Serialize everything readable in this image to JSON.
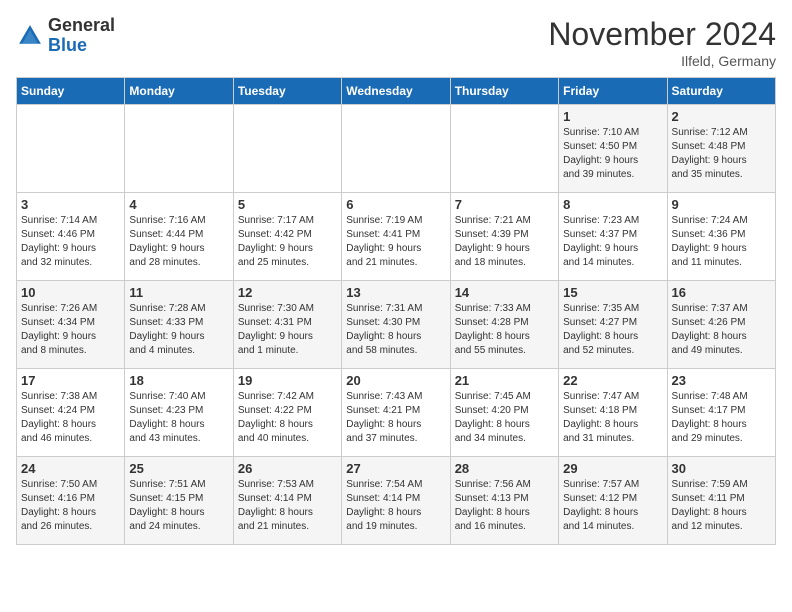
{
  "logo": {
    "general": "General",
    "blue": "Blue"
  },
  "title": "November 2024",
  "location": "Ilfeld, Germany",
  "days_of_week": [
    "Sunday",
    "Monday",
    "Tuesday",
    "Wednesday",
    "Thursday",
    "Friday",
    "Saturday"
  ],
  "weeks": [
    [
      {
        "day": "",
        "info": ""
      },
      {
        "day": "",
        "info": ""
      },
      {
        "day": "",
        "info": ""
      },
      {
        "day": "",
        "info": ""
      },
      {
        "day": "",
        "info": ""
      },
      {
        "day": "1",
        "info": "Sunrise: 7:10 AM\nSunset: 4:50 PM\nDaylight: 9 hours\nand 39 minutes."
      },
      {
        "day": "2",
        "info": "Sunrise: 7:12 AM\nSunset: 4:48 PM\nDaylight: 9 hours\nand 35 minutes."
      }
    ],
    [
      {
        "day": "3",
        "info": "Sunrise: 7:14 AM\nSunset: 4:46 PM\nDaylight: 9 hours\nand 32 minutes."
      },
      {
        "day": "4",
        "info": "Sunrise: 7:16 AM\nSunset: 4:44 PM\nDaylight: 9 hours\nand 28 minutes."
      },
      {
        "day": "5",
        "info": "Sunrise: 7:17 AM\nSunset: 4:42 PM\nDaylight: 9 hours\nand 25 minutes."
      },
      {
        "day": "6",
        "info": "Sunrise: 7:19 AM\nSunset: 4:41 PM\nDaylight: 9 hours\nand 21 minutes."
      },
      {
        "day": "7",
        "info": "Sunrise: 7:21 AM\nSunset: 4:39 PM\nDaylight: 9 hours\nand 18 minutes."
      },
      {
        "day": "8",
        "info": "Sunrise: 7:23 AM\nSunset: 4:37 PM\nDaylight: 9 hours\nand 14 minutes."
      },
      {
        "day": "9",
        "info": "Sunrise: 7:24 AM\nSunset: 4:36 PM\nDaylight: 9 hours\nand 11 minutes."
      }
    ],
    [
      {
        "day": "10",
        "info": "Sunrise: 7:26 AM\nSunset: 4:34 PM\nDaylight: 9 hours\nand 8 minutes."
      },
      {
        "day": "11",
        "info": "Sunrise: 7:28 AM\nSunset: 4:33 PM\nDaylight: 9 hours\nand 4 minutes."
      },
      {
        "day": "12",
        "info": "Sunrise: 7:30 AM\nSunset: 4:31 PM\nDaylight: 9 hours\nand 1 minute."
      },
      {
        "day": "13",
        "info": "Sunrise: 7:31 AM\nSunset: 4:30 PM\nDaylight: 8 hours\nand 58 minutes."
      },
      {
        "day": "14",
        "info": "Sunrise: 7:33 AM\nSunset: 4:28 PM\nDaylight: 8 hours\nand 55 minutes."
      },
      {
        "day": "15",
        "info": "Sunrise: 7:35 AM\nSunset: 4:27 PM\nDaylight: 8 hours\nand 52 minutes."
      },
      {
        "day": "16",
        "info": "Sunrise: 7:37 AM\nSunset: 4:26 PM\nDaylight: 8 hours\nand 49 minutes."
      }
    ],
    [
      {
        "day": "17",
        "info": "Sunrise: 7:38 AM\nSunset: 4:24 PM\nDaylight: 8 hours\nand 46 minutes."
      },
      {
        "day": "18",
        "info": "Sunrise: 7:40 AM\nSunset: 4:23 PM\nDaylight: 8 hours\nand 43 minutes."
      },
      {
        "day": "19",
        "info": "Sunrise: 7:42 AM\nSunset: 4:22 PM\nDaylight: 8 hours\nand 40 minutes."
      },
      {
        "day": "20",
        "info": "Sunrise: 7:43 AM\nSunset: 4:21 PM\nDaylight: 8 hours\nand 37 minutes."
      },
      {
        "day": "21",
        "info": "Sunrise: 7:45 AM\nSunset: 4:20 PM\nDaylight: 8 hours\nand 34 minutes."
      },
      {
        "day": "22",
        "info": "Sunrise: 7:47 AM\nSunset: 4:18 PM\nDaylight: 8 hours\nand 31 minutes."
      },
      {
        "day": "23",
        "info": "Sunrise: 7:48 AM\nSunset: 4:17 PM\nDaylight: 8 hours\nand 29 minutes."
      }
    ],
    [
      {
        "day": "24",
        "info": "Sunrise: 7:50 AM\nSunset: 4:16 PM\nDaylight: 8 hours\nand 26 minutes."
      },
      {
        "day": "25",
        "info": "Sunrise: 7:51 AM\nSunset: 4:15 PM\nDaylight: 8 hours\nand 24 minutes."
      },
      {
        "day": "26",
        "info": "Sunrise: 7:53 AM\nSunset: 4:14 PM\nDaylight: 8 hours\nand 21 minutes."
      },
      {
        "day": "27",
        "info": "Sunrise: 7:54 AM\nSunset: 4:14 PM\nDaylight: 8 hours\nand 19 minutes."
      },
      {
        "day": "28",
        "info": "Sunrise: 7:56 AM\nSunset: 4:13 PM\nDaylight: 8 hours\nand 16 minutes."
      },
      {
        "day": "29",
        "info": "Sunrise: 7:57 AM\nSunset: 4:12 PM\nDaylight: 8 hours\nand 14 minutes."
      },
      {
        "day": "30",
        "info": "Sunrise: 7:59 AM\nSunset: 4:11 PM\nDaylight: 8 hours\nand 12 minutes."
      }
    ]
  ]
}
